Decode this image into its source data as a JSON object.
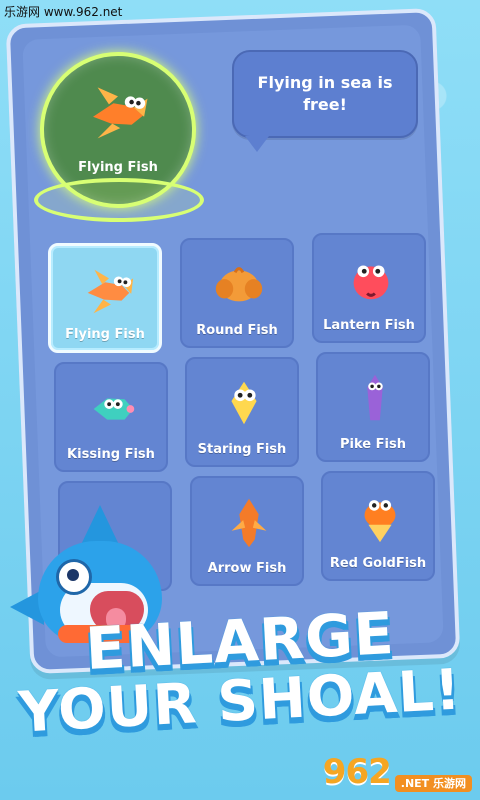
{
  "watermark": "乐游网 www.962.net",
  "speech_text": "Flying in sea is free!",
  "selected_fish": "Flying Fish",
  "fish_cards": [
    {
      "label": "Flying Fish",
      "icon": "flying-fish-icon",
      "color": "#ff8c42"
    },
    {
      "label": "Round Fish",
      "icon": "round-fish-icon",
      "color": "#f39b38"
    },
    {
      "label": "Lantern Fish",
      "icon": "lantern-fish-icon",
      "color": "#ff4d5c"
    },
    {
      "label": "Kissing Fish",
      "icon": "kissing-fish-icon",
      "color": "#3fd0bf"
    },
    {
      "label": "Staring Fish",
      "icon": "staring-fish-icon",
      "color": "#ffd84f"
    },
    {
      "label": "Pike Fish",
      "icon": "pike-fish-icon",
      "color": "#9a62d8"
    },
    {
      "label": "Arrow Fish",
      "icon": "arrow-fish-icon",
      "color": "#f47b29"
    },
    {
      "label": "Red GoldFish",
      "icon": "red-goldfish-icon",
      "color": "#ff7f21"
    }
  ],
  "headline": {
    "line1": "ENLARGE",
    "line2": "YOUR SHOAL!"
  },
  "site_badge": {
    "number": "962",
    "text": ".NET 乐游网"
  }
}
